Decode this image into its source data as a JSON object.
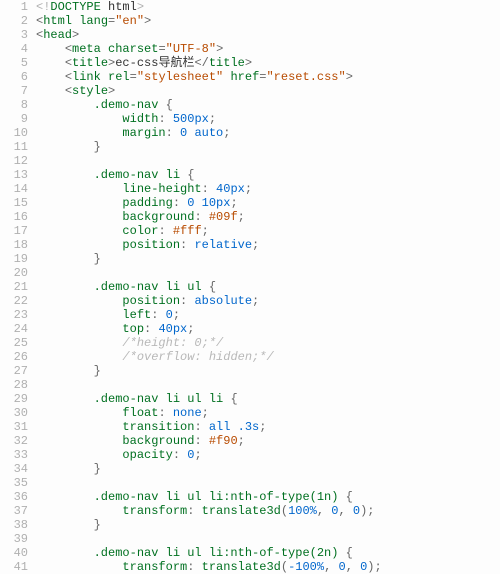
{
  "lines": [
    {
      "n": 1,
      "indent": "",
      "tokens": [
        {
          "c": "t-doctype",
          "t": "<!"
        },
        {
          "c": "t-tag",
          "t": "DOCTYPE"
        },
        {
          "c": "t-text",
          "t": " html"
        },
        {
          "c": "t-doctype",
          "t": ">"
        }
      ]
    },
    {
      "n": 2,
      "indent": "",
      "tokens": [
        {
          "c": "t-punct",
          "t": "<"
        },
        {
          "c": "t-tag",
          "t": "html"
        },
        {
          "c": "t-text",
          "t": " "
        },
        {
          "c": "t-attr",
          "t": "lang"
        },
        {
          "c": "t-punct",
          "t": "="
        },
        {
          "c": "t-string",
          "t": "\"en\""
        },
        {
          "c": "t-punct",
          "t": ">"
        }
      ]
    },
    {
      "n": 3,
      "indent": "",
      "tokens": [
        {
          "c": "t-punct",
          "t": "<"
        },
        {
          "c": "t-tag",
          "t": "head"
        },
        {
          "c": "t-punct",
          "t": ">"
        }
      ]
    },
    {
      "n": 4,
      "indent": "    ",
      "tokens": [
        {
          "c": "t-punct",
          "t": "<"
        },
        {
          "c": "t-tag",
          "t": "meta"
        },
        {
          "c": "t-text",
          "t": " "
        },
        {
          "c": "t-attr",
          "t": "charset"
        },
        {
          "c": "t-punct",
          "t": "="
        },
        {
          "c": "t-string",
          "t": "\"UTF-8\""
        },
        {
          "c": "t-punct",
          "t": ">"
        }
      ]
    },
    {
      "n": 5,
      "indent": "    ",
      "tokens": [
        {
          "c": "t-punct",
          "t": "<"
        },
        {
          "c": "t-tag",
          "t": "title"
        },
        {
          "c": "t-punct",
          "t": ">"
        },
        {
          "c": "t-text",
          "t": "ec-css导航栏"
        },
        {
          "c": "t-punct",
          "t": "</"
        },
        {
          "c": "t-tag",
          "t": "title"
        },
        {
          "c": "t-punct",
          "t": ">"
        }
      ]
    },
    {
      "n": 6,
      "indent": "    ",
      "tokens": [
        {
          "c": "t-punct",
          "t": "<"
        },
        {
          "c": "t-tag",
          "t": "link"
        },
        {
          "c": "t-text",
          "t": " "
        },
        {
          "c": "t-attr",
          "t": "rel"
        },
        {
          "c": "t-punct",
          "t": "="
        },
        {
          "c": "t-string",
          "t": "\"stylesheet\""
        },
        {
          "c": "t-text",
          "t": " "
        },
        {
          "c": "t-attr",
          "t": "href"
        },
        {
          "c": "t-punct",
          "t": "="
        },
        {
          "c": "t-string",
          "t": "\"reset.css\""
        },
        {
          "c": "t-punct",
          "t": ">"
        }
      ]
    },
    {
      "n": 7,
      "indent": "    ",
      "tokens": [
        {
          "c": "t-punct",
          "t": "<"
        },
        {
          "c": "t-tag",
          "t": "style"
        },
        {
          "c": "t-punct",
          "t": ">"
        }
      ]
    },
    {
      "n": 8,
      "indent": "        ",
      "tokens": [
        {
          "c": "t-selector",
          "t": ".demo-nav"
        },
        {
          "c": "t-text",
          "t": " "
        },
        {
          "c": "t-punct",
          "t": "{"
        }
      ]
    },
    {
      "n": 9,
      "indent": "            ",
      "tokens": [
        {
          "c": "t-prop",
          "t": "width"
        },
        {
          "c": "t-punct",
          "t": ": "
        },
        {
          "c": "t-num",
          "t": "500px"
        },
        {
          "c": "t-punct",
          "t": ";"
        }
      ]
    },
    {
      "n": 10,
      "indent": "            ",
      "tokens": [
        {
          "c": "t-prop",
          "t": "margin"
        },
        {
          "c": "t-punct",
          "t": ": "
        },
        {
          "c": "t-num",
          "t": "0"
        },
        {
          "c": "t-text",
          "t": " "
        },
        {
          "c": "t-kw",
          "t": "auto"
        },
        {
          "c": "t-punct",
          "t": ";"
        }
      ]
    },
    {
      "n": 11,
      "indent": "        ",
      "tokens": [
        {
          "c": "t-punct",
          "t": "}"
        }
      ]
    },
    {
      "n": 12,
      "indent": "",
      "tokens": []
    },
    {
      "n": 13,
      "indent": "        ",
      "tokens": [
        {
          "c": "t-selector",
          "t": ".demo-nav li"
        },
        {
          "c": "t-text",
          "t": " "
        },
        {
          "c": "t-punct",
          "t": "{"
        }
      ]
    },
    {
      "n": 14,
      "indent": "            ",
      "tokens": [
        {
          "c": "t-prop",
          "t": "line-height"
        },
        {
          "c": "t-punct",
          "t": ": "
        },
        {
          "c": "t-num",
          "t": "40px"
        },
        {
          "c": "t-punct",
          "t": ";"
        }
      ]
    },
    {
      "n": 15,
      "indent": "            ",
      "tokens": [
        {
          "c": "t-prop",
          "t": "padding"
        },
        {
          "c": "t-punct",
          "t": ": "
        },
        {
          "c": "t-num",
          "t": "0"
        },
        {
          "c": "t-text",
          "t": " "
        },
        {
          "c": "t-num",
          "t": "10px"
        },
        {
          "c": "t-punct",
          "t": ";"
        }
      ]
    },
    {
      "n": 16,
      "indent": "            ",
      "tokens": [
        {
          "c": "t-prop",
          "t": "background"
        },
        {
          "c": "t-punct",
          "t": ": "
        },
        {
          "c": "t-hex",
          "t": "#09f"
        },
        {
          "c": "t-punct",
          "t": ";"
        }
      ]
    },
    {
      "n": 17,
      "indent": "            ",
      "tokens": [
        {
          "c": "t-prop",
          "t": "color"
        },
        {
          "c": "t-punct",
          "t": ": "
        },
        {
          "c": "t-hex",
          "t": "#fff"
        },
        {
          "c": "t-punct",
          "t": ";"
        }
      ]
    },
    {
      "n": 18,
      "indent": "            ",
      "tokens": [
        {
          "c": "t-prop",
          "t": "position"
        },
        {
          "c": "t-punct",
          "t": ": "
        },
        {
          "c": "t-kw",
          "t": "relative"
        },
        {
          "c": "t-punct",
          "t": ";"
        }
      ]
    },
    {
      "n": 19,
      "indent": "        ",
      "tokens": [
        {
          "c": "t-punct",
          "t": "}"
        }
      ]
    },
    {
      "n": 20,
      "indent": "",
      "tokens": []
    },
    {
      "n": 21,
      "indent": "        ",
      "tokens": [
        {
          "c": "t-selector",
          "t": ".demo-nav li ul"
        },
        {
          "c": "t-text",
          "t": " "
        },
        {
          "c": "t-punct",
          "t": "{"
        }
      ]
    },
    {
      "n": 22,
      "indent": "            ",
      "tokens": [
        {
          "c": "t-prop",
          "t": "position"
        },
        {
          "c": "t-punct",
          "t": ": "
        },
        {
          "c": "t-kw",
          "t": "absolute"
        },
        {
          "c": "t-punct",
          "t": ";"
        }
      ]
    },
    {
      "n": 23,
      "indent": "            ",
      "tokens": [
        {
          "c": "t-prop",
          "t": "left"
        },
        {
          "c": "t-punct",
          "t": ": "
        },
        {
          "c": "t-num",
          "t": "0"
        },
        {
          "c": "t-punct",
          "t": ";"
        }
      ]
    },
    {
      "n": 24,
      "indent": "            ",
      "tokens": [
        {
          "c": "t-prop",
          "t": "top"
        },
        {
          "c": "t-punct",
          "t": ": "
        },
        {
          "c": "t-num",
          "t": "40px"
        },
        {
          "c": "t-punct",
          "t": ";"
        }
      ]
    },
    {
      "n": 25,
      "indent": "            ",
      "tokens": [
        {
          "c": "t-comment",
          "t": "/*height: 0;*/"
        }
      ]
    },
    {
      "n": 26,
      "indent": "            ",
      "tokens": [
        {
          "c": "t-comment",
          "t": "/*overflow: hidden;*/"
        }
      ]
    },
    {
      "n": 27,
      "indent": "        ",
      "tokens": [
        {
          "c": "t-punct",
          "t": "}"
        }
      ]
    },
    {
      "n": 28,
      "indent": "",
      "tokens": []
    },
    {
      "n": 29,
      "indent": "        ",
      "tokens": [
        {
          "c": "t-selector",
          "t": ".demo-nav li ul li"
        },
        {
          "c": "t-text",
          "t": " "
        },
        {
          "c": "t-punct",
          "t": "{"
        }
      ]
    },
    {
      "n": 30,
      "indent": "            ",
      "tokens": [
        {
          "c": "t-prop",
          "t": "float"
        },
        {
          "c": "t-punct",
          "t": ": "
        },
        {
          "c": "t-kw",
          "t": "none"
        },
        {
          "c": "t-punct",
          "t": ";"
        }
      ]
    },
    {
      "n": 31,
      "indent": "            ",
      "tokens": [
        {
          "c": "t-prop",
          "t": "transition"
        },
        {
          "c": "t-punct",
          "t": ": "
        },
        {
          "c": "t-kw",
          "t": "all"
        },
        {
          "c": "t-text",
          "t": " "
        },
        {
          "c": "t-num",
          "t": ".3s"
        },
        {
          "c": "t-punct",
          "t": ";"
        }
      ]
    },
    {
      "n": 32,
      "indent": "            ",
      "tokens": [
        {
          "c": "t-prop",
          "t": "background"
        },
        {
          "c": "t-punct",
          "t": ": "
        },
        {
          "c": "t-hex",
          "t": "#f90"
        },
        {
          "c": "t-punct",
          "t": ";"
        }
      ]
    },
    {
      "n": 33,
      "indent": "            ",
      "tokens": [
        {
          "c": "t-prop",
          "t": "opacity"
        },
        {
          "c": "t-punct",
          "t": ": "
        },
        {
          "c": "t-num",
          "t": "0"
        },
        {
          "c": "t-punct",
          "t": ";"
        }
      ]
    },
    {
      "n": 34,
      "indent": "        ",
      "tokens": [
        {
          "c": "t-punct",
          "t": "}"
        }
      ]
    },
    {
      "n": 35,
      "indent": "",
      "tokens": []
    },
    {
      "n": 36,
      "indent": "        ",
      "tokens": [
        {
          "c": "t-selector",
          "t": ".demo-nav li ul li:nth-of-type(1n)"
        },
        {
          "c": "t-text",
          "t": " "
        },
        {
          "c": "t-punct",
          "t": "{"
        }
      ]
    },
    {
      "n": 37,
      "indent": "            ",
      "tokens": [
        {
          "c": "t-prop",
          "t": "transform"
        },
        {
          "c": "t-punct",
          "t": ": "
        },
        {
          "c": "t-val",
          "t": "translate3d"
        },
        {
          "c": "t-punct",
          "t": "("
        },
        {
          "c": "t-num",
          "t": "100%"
        },
        {
          "c": "t-punct",
          "t": ", "
        },
        {
          "c": "t-num",
          "t": "0"
        },
        {
          "c": "t-punct",
          "t": ", "
        },
        {
          "c": "t-num",
          "t": "0"
        },
        {
          "c": "t-punct",
          "t": ");"
        }
      ]
    },
    {
      "n": 38,
      "indent": "        ",
      "tokens": [
        {
          "c": "t-punct",
          "t": "}"
        }
      ]
    },
    {
      "n": 39,
      "indent": "",
      "tokens": []
    },
    {
      "n": 40,
      "indent": "        ",
      "tokens": [
        {
          "c": "t-selector",
          "t": ".demo-nav li ul li:nth-of-type(2n)"
        },
        {
          "c": "t-text",
          "t": " "
        },
        {
          "c": "t-punct",
          "t": "{"
        }
      ]
    },
    {
      "n": 41,
      "indent": "            ",
      "tokens": [
        {
          "c": "t-prop",
          "t": "transform"
        },
        {
          "c": "t-punct",
          "t": ": "
        },
        {
          "c": "t-val",
          "t": "translate3d"
        },
        {
          "c": "t-punct",
          "t": "("
        },
        {
          "c": "t-num",
          "t": "-100%"
        },
        {
          "c": "t-punct",
          "t": ", "
        },
        {
          "c": "t-num",
          "t": "0"
        },
        {
          "c": "t-punct",
          "t": ", "
        },
        {
          "c": "t-num",
          "t": "0"
        },
        {
          "c": "t-punct",
          "t": ");"
        }
      ]
    }
  ]
}
